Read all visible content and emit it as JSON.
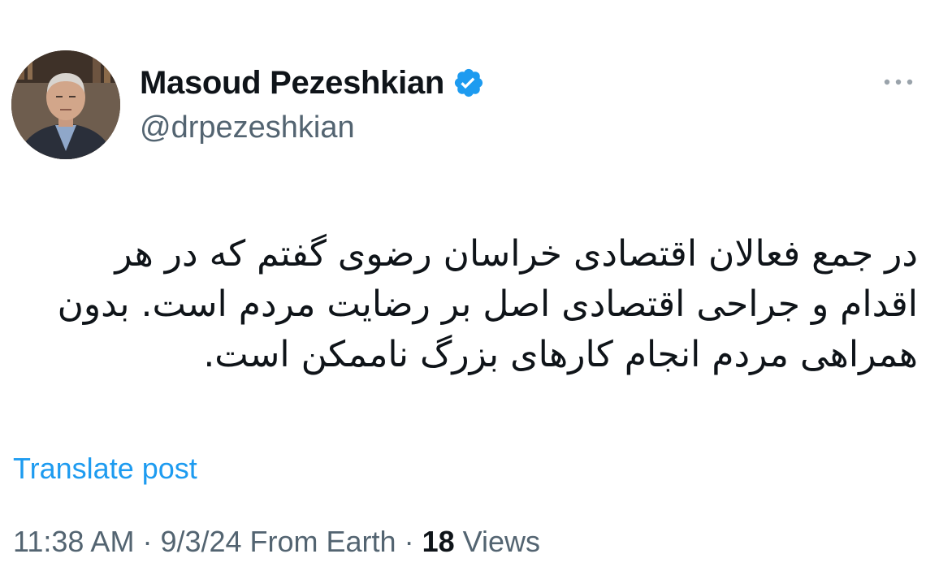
{
  "author": {
    "display_name": "Masoud Pezeshkian",
    "handle": "@drpezeshkian",
    "verified": true
  },
  "post": {
    "text": "در جمع فعالان اقتصادی خراسان رضوی گفتم که در هر\nاقدام و جراحی اقتصادی اصل بر رضایت مردم است. بدون\nهمراهی مردم انجام کارهای بزرگ ناممکن است.",
    "translate_label": "Translate post"
  },
  "meta": {
    "time": "11:38 AM",
    "sep1": " · ",
    "date": "9/3/24",
    "source": " From Earth",
    "sep2": " · ",
    "views_count": "18",
    "views_label": " Views"
  },
  "icons": {
    "verified": "verified-badge-icon",
    "more": "more-options-icon"
  },
  "colors": {
    "accent": "#1d9bf0",
    "text": "#0f1419",
    "secondary": "#536471"
  }
}
